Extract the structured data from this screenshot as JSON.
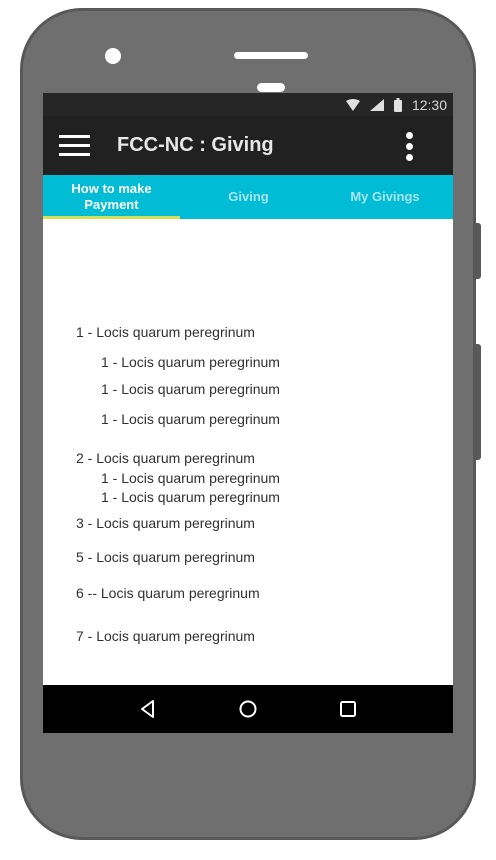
{
  "status_bar": {
    "time": "12:30",
    "icons": [
      "wifi-icon",
      "signal-icon",
      "battery-icon"
    ]
  },
  "app_bar": {
    "title": "FCC-NC : Giving",
    "left_icon": "menu-icon",
    "right_icon": "overflow-menu-icon"
  },
  "tabs": [
    {
      "label_line1": "How to make",
      "label_line2": "Payment",
      "active": true
    },
    {
      "label": "Giving",
      "active": false
    },
    {
      "label": "My Givings",
      "active": false
    }
  ],
  "colors": {
    "tab_bar": "#00bcd4",
    "tab_indicator": "#d4e157",
    "app_bar": "#212121",
    "status_bar": "#262626"
  },
  "content": {
    "items": [
      "1 - Locis quarum peregrinum",
      "1 - Locis quarum peregrinum",
      "1 - Locis quarum peregrinum",
      "1 - Locis quarum peregrinum",
      "2 - Locis quarum peregrinum",
      "1 - Locis quarum peregrinum",
      "1 - Locis quarum peregrinum",
      "3 - Locis quarum peregrinum",
      "5 - Locis quarum peregrinum",
      "6 -- Locis quarum peregrinum",
      "7 - Locis quarum peregrinum"
    ]
  },
  "nav_bar": {
    "buttons": [
      "back-icon",
      "home-icon",
      "recents-icon"
    ]
  }
}
